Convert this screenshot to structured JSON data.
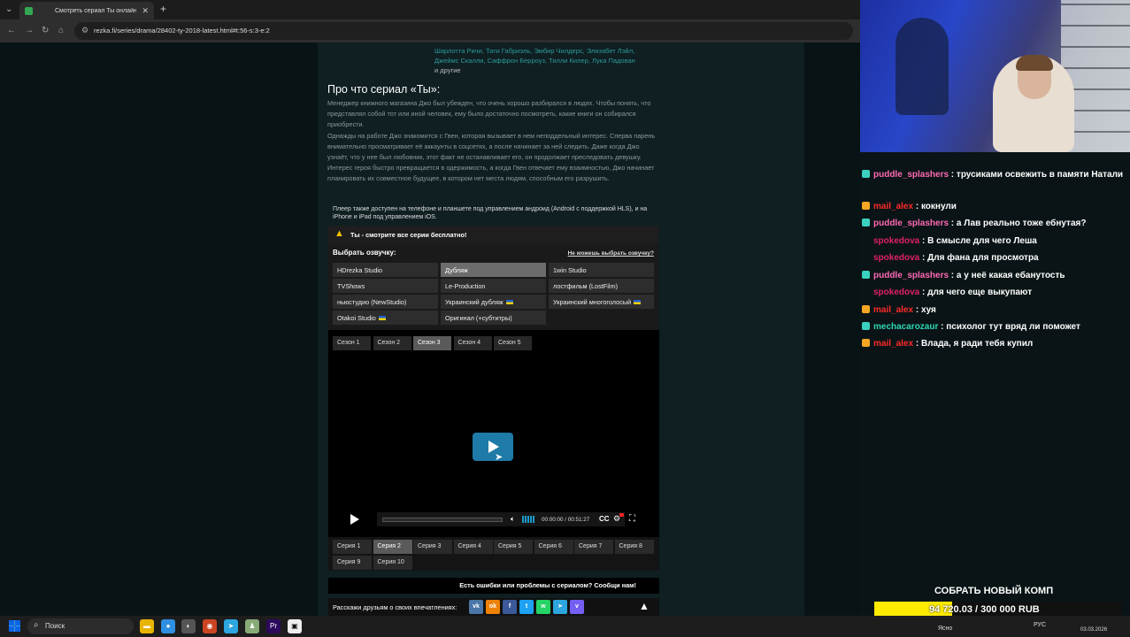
{
  "browser": {
    "tab_title": "Смотреть сериал Ты онлайн",
    "url": "rezka.fi/series/drama/28402-ty-2018-latest.html#t:56-s:3-e:2"
  },
  "actors": {
    "line1": [
      "Шарлотта Ричи",
      "Тати Габриэль",
      "Эмбир Чилдерс",
      "Элизабет Лэйл"
    ],
    "line2": [
      "Джеймс Скалли",
      "Саффрон Берроуз",
      "Тилли Килер",
      "Лука Падован"
    ],
    "more": "и другие"
  },
  "about": {
    "heading": "Про что сериал «Ты»:",
    "p1": "Менеджер книжного магазина Джо был убежден, что очень хорошо разбирался в людях. Чтобы понять, что представлял собой тот или иной человек, ему было достаточно посмотреть, какие книги он собирался приобрести.",
    "p2": "Однажды на работе Джо знакомится с Гвен, которая вызывает в нем неподдельный интерес. Сперва парень внимательно просматривает её аккаунты в соцсетях, а после начинает за ней следить. Даже когда Джо узнаёт, что у нее был любовник, этот факт не останавливает его, он продолжает преследовать девушку. Интерес героя быстро превращается в одержимость, а когда Гвен отвечает ему взаимностью, Джо начинает планировать их совместное будущее, в котором нет места людям, способным его разрушить."
  },
  "mobile_note": "Плеер также доступен на телефоне и планшете под управлением андроид (Android с поддержкой HLS), и на iPhone и iPad под управлением iOS.",
  "free_banner": "Ты - смотрите все серии бесплатно!",
  "dub": {
    "label": "Выбрать озвучку:",
    "help": "Не можешь выбрать озвучку?",
    "items": [
      {
        "label": "HDrezka Studio",
        "flag": false,
        "active": false
      },
      {
        "label": "Дубляж",
        "flag": false,
        "active": true
      },
      {
        "label": "1win Studio",
        "flag": false,
        "active": false
      },
      {
        "label": "TVShows",
        "flag": false,
        "active": false
      },
      {
        "label": "Le-Production",
        "flag": false,
        "active": false
      },
      {
        "label": "лостфильм (LostFilm)",
        "flag": false,
        "active": false
      },
      {
        "label": "ньюстудио (NewStudio)",
        "flag": false,
        "active": false
      },
      {
        "label": "Украинский дубляж",
        "flag": true,
        "active": false
      },
      {
        "label": "Украинский многоголосый",
        "flag": true,
        "active": false
      },
      {
        "label": "Otakoi Studio",
        "flag": true,
        "active": false
      },
      {
        "label": "Оригинал (+субтитры)",
        "flag": false,
        "active": false
      }
    ]
  },
  "seasons": [
    "Сезон 1",
    "Сезон 2",
    "Сезон 3",
    "Сезон 4",
    "Сезон 5"
  ],
  "active_season": 2,
  "player": {
    "time": "00:00:00 / 00:51:27",
    "cc": "CC"
  },
  "episodes": [
    "Серия 1",
    "Серия 2",
    "Серия 3",
    "Серия 4",
    "Серия 5",
    "Серия 6",
    "Серия 7",
    "Серия 8",
    "Серия 9",
    "Серия 10"
  ],
  "active_episode": 1,
  "error_text": "Есть ошибки или проблемы с сериалом? Сообщи нам!",
  "share_text": "Расскажи друзьям о своих впечатлениях:",
  "share_icons": [
    {
      "name": "vk-icon",
      "glyph": "vk",
      "color": "#4a76a8"
    },
    {
      "name": "odnoklassniki-icon",
      "glyph": "ok",
      "color": "#ee8208"
    },
    {
      "name": "facebook-icon",
      "glyph": "f",
      "color": "#3b5998"
    },
    {
      "name": "twitter-icon",
      "glyph": "t",
      "color": "#1da1f2"
    },
    {
      "name": "whatsapp-icon",
      "glyph": "w",
      "color": "#25d366"
    },
    {
      "name": "telegram-icon",
      "glyph": "➤",
      "color": "#2ca5e0"
    },
    {
      "name": "viber-icon",
      "glyph": "v",
      "color": "#7360f2"
    }
  ],
  "chat": [
    {
      "user": "puddle_splashers",
      "color": "#ff69b4",
      "badge": "#3ad1c1",
      "text": "трусиками освежить в памяти Натали"
    },
    {
      "user": "mail_alex",
      "color": "#ff2a2a",
      "badge": "#f5a623",
      "text": "кокнули"
    },
    {
      "user": "puddle_splashers",
      "color": "#ff69b4",
      "badge": "#3ad1c1",
      "text": "а Лав реально тоже ебнутая?"
    },
    {
      "user": "spokedova",
      "color": "#e0206a",
      "badge": "",
      "text": "В смысле для чего Леша"
    },
    {
      "user": "spokedova",
      "color": "#e0206a",
      "badge": "",
      "text": "Для фана для просмотра"
    },
    {
      "user": "puddle_splashers",
      "color": "#ff69b4",
      "badge": "#3ad1c1",
      "text": "а у неё какая ебанутость"
    },
    {
      "user": "spokedova",
      "color": "#e0206a",
      "badge": "",
      "text": "для чего еще выкупают"
    },
    {
      "user": "mail_alex",
      "color": "#ff2a2a",
      "badge": "#f5a623",
      "text": "хуя"
    },
    {
      "user": "mechacarozaur",
      "color": "#2fd6b5",
      "badge": "#3ad1c1",
      "text": "психолог тут вряд ли поможет"
    },
    {
      "user": "mail_alex",
      "color": "#ff2a2a",
      "badge": "#f5a623",
      "text": "Влада, я ради тебя купил"
    }
  ],
  "goal": {
    "title": "СОБРАТЬ НОВЫЙ КОМП",
    "text": "94 720.03 / 300 000 RUB",
    "fraction": 0.3157
  },
  "taskbar": {
    "search": "Поиск",
    "weather": "Ясно",
    "lang": "РУС",
    "date": "03.03.2026"
  }
}
